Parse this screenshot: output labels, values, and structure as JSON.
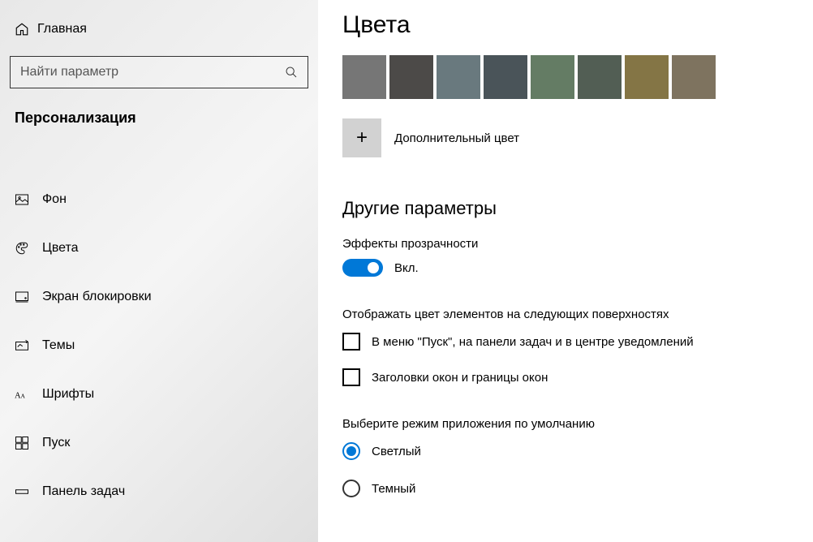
{
  "sidebar": {
    "home": "Главная",
    "search_placeholder": "Найти параметр",
    "category": "Персонализация",
    "items": [
      {
        "label": "Фон"
      },
      {
        "label": "Цвета"
      },
      {
        "label": "Экран блокировки"
      },
      {
        "label": "Темы"
      },
      {
        "label": "Шрифты"
      },
      {
        "label": "Пуск"
      },
      {
        "label": "Панель задач"
      }
    ]
  },
  "main": {
    "title": "Цвета",
    "swatches": [
      "#767676",
      "#4c4a48",
      "#69797e",
      "#4a5459",
      "#647c64",
      "#525e54",
      "#847545",
      "#7e735f"
    ],
    "custom_color": "Дополнительный цвет",
    "other_params": "Другие параметры",
    "transparency_label": "Эффекты прозрачности",
    "transparency_state": "Вкл.",
    "accent_surfaces_label": "Отображать цвет элементов на следующих поверхностях",
    "checkbox1": "В меню \"Пуск\", на панели задач и в центре уведомлений",
    "checkbox2": "Заголовки окон и границы окон",
    "app_mode_label": "Выберите режим приложения по умолчанию",
    "radio_light": "Светлый",
    "radio_dark": "Темный"
  }
}
